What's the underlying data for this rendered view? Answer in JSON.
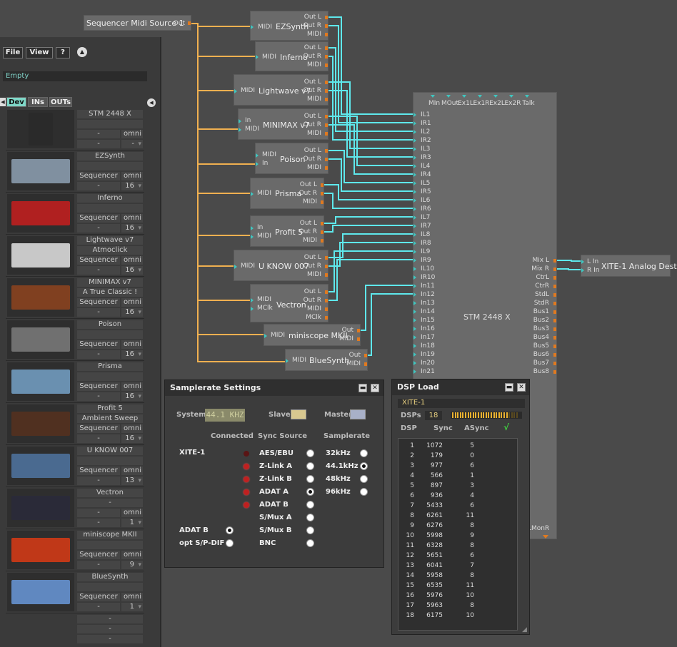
{
  "menu": {
    "file": "File",
    "view": "View",
    "help": "?"
  },
  "browser": {
    "empty_label": "Empty",
    "tabs": [
      "Dev",
      "INs",
      "OUTs"
    ],
    "devices": [
      {
        "name": "STM 2448 X",
        "line2": "",
        "conn": "-",
        "port": "omni",
        "chan": "-"
      },
      {
        "name": "EZSynth",
        "line2": "",
        "conn": "Sequencer",
        "port": "omni",
        "chan": "16"
      },
      {
        "name": "Inferno",
        "line2": "",
        "conn": "Sequencer",
        "port": "omni",
        "chan": "16"
      },
      {
        "name": "Lightwave v7",
        "line2": "Atmoclick",
        "conn": "Sequencer",
        "port": "omni",
        "chan": "16"
      },
      {
        "name": "MINIMAX v7",
        "line2": "A True Classic !",
        "conn": "Sequencer",
        "port": "omni",
        "chan": "16"
      },
      {
        "name": "Poison",
        "line2": "",
        "conn": "Sequencer",
        "port": "omni",
        "chan": "16"
      },
      {
        "name": "Prisma",
        "line2": "",
        "conn": "Sequencer",
        "port": "omni",
        "chan": "16"
      },
      {
        "name": "Profit 5",
        "line2": "Ambient Sweep",
        "conn": "Sequencer",
        "port": "omni",
        "chan": "16"
      },
      {
        "name": "U KNOW 007",
        "line2": "",
        "conn": "Sequencer",
        "port": "omni",
        "chan": "13"
      },
      {
        "name": "Vectron",
        "line2": "-",
        "conn": "-",
        "port": "omni",
        "chan": "1"
      },
      {
        "name": "miniscope MKII",
        "line2": "",
        "conn": "Sequencer",
        "port": "omni",
        "chan": "9"
      },
      {
        "name": "BlueSynth",
        "line2": "",
        "conn": "Sequencer",
        "port": "omni",
        "chan": "1"
      }
    ],
    "footer": [
      "-",
      "-",
      "-"
    ]
  },
  "source": {
    "label": "Sequencer Midi Source 1",
    "port": "Out"
  },
  "nodes": {
    "ezsynth": {
      "title": "EZSynth",
      "in1": "MIDI",
      "out1": "Out L",
      "out2": "Out R",
      "out3": "MIDI"
    },
    "inferno": {
      "title": "Inferno",
      "in1": "MIDI",
      "out1": "Out L",
      "out2": "Out R",
      "out3": "MIDI"
    },
    "lightwave": {
      "title": "Lightwave v7",
      "in1": "MIDI",
      "out1": "Out L",
      "out2": "Out R",
      "out3": "MIDI"
    },
    "minimax": {
      "title": "MINIMAX v7",
      "in1": "In",
      "in2": "MIDI",
      "out1": "Out L",
      "out2": "Out R",
      "out3": "MIDI"
    },
    "poison": {
      "title": "Poison",
      "in1": "MIDI",
      "in2": "In",
      "out1": "Out L",
      "out2": "Out R",
      "out3": "MIDI"
    },
    "prisma": {
      "title": "Prisma",
      "in1": "MIDI",
      "out1": "Out L",
      "out2": "Out R",
      "out3": "MIDI"
    },
    "profit": {
      "title": "Profit 5",
      "in1": "In",
      "in2": "MIDI",
      "out1": "Out L",
      "out2": "Out R",
      "out3": "MIDI"
    },
    "uknow": {
      "title": "U KNOW 007",
      "in1": "MIDI",
      "out1": "Out L",
      "out2": "Out R",
      "out3": "MIDI"
    },
    "vectron": {
      "title": "Vectron",
      "in1": "MIDI",
      "in2": "MClk",
      "out1": "Out L",
      "out2": "Out R",
      "out3": "MIDI",
      "out4": "MClk"
    },
    "miniscope": {
      "title": "miniscope MKII",
      "in1": "MIDI",
      "out1": "Out",
      "out2": "MIDI"
    },
    "bluesynth": {
      "title": "BlueSynth",
      "in1": "MIDI",
      "out1": "Out",
      "out2": "MIDI"
    }
  },
  "stm": {
    "title": "STM 2448 X",
    "top_ports": [
      "MIn",
      "MOut",
      "Ex1L",
      "Ex1R",
      "Ex2L",
      "Ex2R",
      "Talk"
    ],
    "inputs": [
      "IL1",
      "IR1",
      "IL2",
      "IR2",
      "IL3",
      "IR3",
      "IL4",
      "IR4",
      "IL5",
      "IR5",
      "IL6",
      "IR6",
      "IL7",
      "IR7",
      "IL8",
      "IR8",
      "IL9",
      "IR9",
      "IL10",
      "IR10",
      "In11",
      "In12",
      "In13",
      "In14",
      "In15",
      "In16",
      "In17",
      "In18",
      "In19",
      "In20",
      "In21"
    ],
    "outputs": [
      "Mix L",
      "Mix R",
      "CtrL",
      "CtrR",
      "StdL",
      "StdR",
      "Bus1",
      "Bus2",
      "Bus3",
      "Bus4",
      "Bus5",
      "Bus6",
      "Bus7",
      "Bus8"
    ],
    "bottom_port": "LMonR"
  },
  "analog_dest": {
    "title": "XITE-1 Analog Dest",
    "in1": "L In",
    "in2": "R In"
  },
  "samplerate": {
    "title": "Samplerate Settings",
    "system_label": "System",
    "system_value": "44.1 KHZ",
    "slave_label": "Slave",
    "master_label": "Master",
    "col_connected": "Connected",
    "col_sync": "Sync Source",
    "col_rate": "Samplerate",
    "device": "XITE-1",
    "sync_sources": [
      "AES/EBU",
      "Z-Link A",
      "Z-Link B",
      "ADAT A",
      "ADAT B",
      "S/Mux A",
      "S/Mux B",
      "BNC"
    ],
    "sync_selected": 3,
    "rates": [
      "32kHz",
      "44.1kHz",
      "48kHz",
      "96kHz"
    ],
    "rate_selected": 1,
    "extra": [
      "ADAT B",
      "opt S/P-DIF"
    ],
    "extra_selected": 0
  },
  "dsp": {
    "title": "DSP Load",
    "device": "XITE-1",
    "dsps_label": "DSPs",
    "dsps_value": "18",
    "col_dsp": "DSP",
    "col_sync": "Sync",
    "col_async": "ASync",
    "rows": [
      [
        "1",
        "1072",
        "5"
      ],
      [
        "2",
        "179",
        "0"
      ],
      [
        "3",
        "977",
        "6"
      ],
      [
        "4",
        "566",
        "1"
      ],
      [
        "5",
        "897",
        "3"
      ],
      [
        "6",
        "936",
        "4"
      ],
      [
        "7",
        "5433",
        "6"
      ],
      [
        "8",
        "6261",
        "11"
      ],
      [
        "9",
        "6276",
        "8"
      ],
      [
        "10",
        "5998",
        "9"
      ],
      [
        "11",
        "6328",
        "8"
      ],
      [
        "12",
        "5651",
        "6"
      ],
      [
        "13",
        "6041",
        "7"
      ],
      [
        "14",
        "5958",
        "8"
      ],
      [
        "15",
        "6535",
        "11"
      ],
      [
        "16",
        "5976",
        "10"
      ],
      [
        "17",
        "5963",
        "8"
      ],
      [
        "18",
        "6175",
        "10"
      ]
    ]
  },
  "colors": {
    "midi_wire": "#f0b050",
    "audio_wire": "#5ee8ec",
    "node": "#6a6a6a",
    "port_in": "#3fc6c0",
    "port_out": "#e07a20"
  }
}
